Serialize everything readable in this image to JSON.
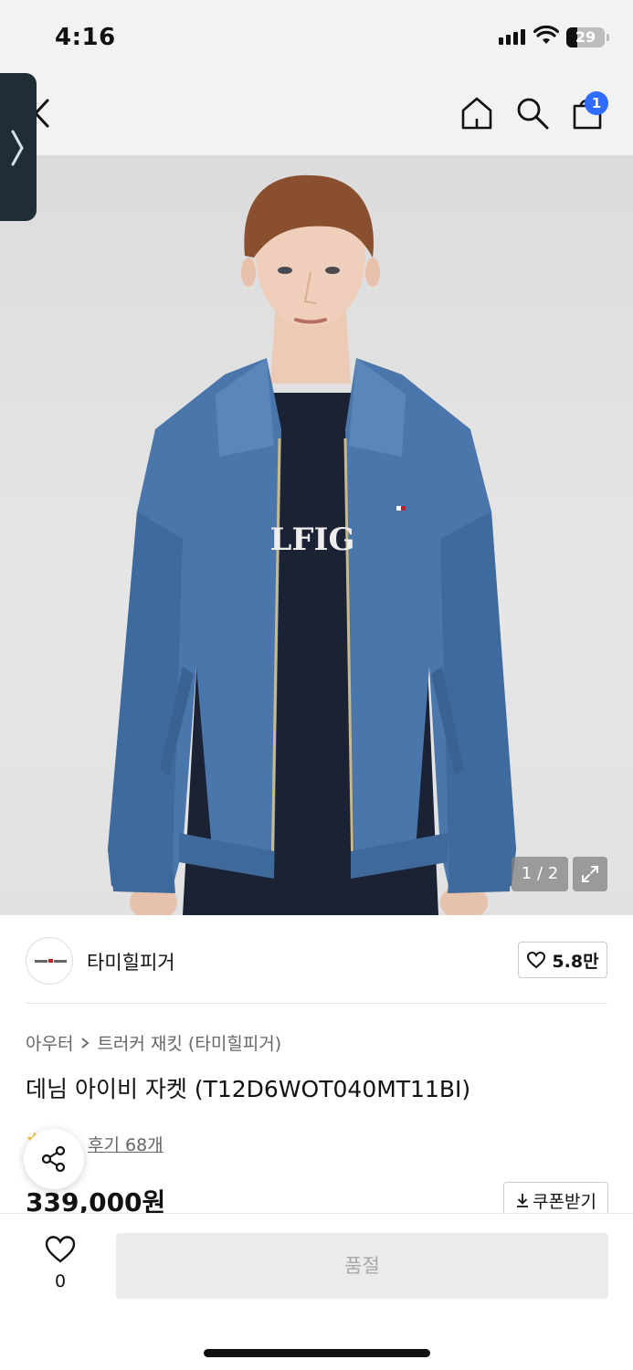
{
  "status_bar": {
    "time": "4:16",
    "battery": "29",
    "battery_level": 0.29
  },
  "header": {
    "cart_count": "1"
  },
  "gallery": {
    "counter": "1 / 2",
    "shirt_print": "LFIG"
  },
  "brand": {
    "name": "타미힐피거",
    "likes": "5.8만",
    "logo_text": "TOMMY HILFIGER"
  },
  "product": {
    "breadcrumb": [
      "아우터",
      "트러커 재킷 (타미힐피거)"
    ],
    "title": "데님 아이비 자켓 (T12D6WOT040MT11BI)",
    "review_link": "후기 68개",
    "price": "339,000원",
    "coupon_label": "쿠폰받기"
  },
  "bottom_bar": {
    "wish_count": "0",
    "buy_button": "품절"
  },
  "colors": {
    "accent": "#2f6bff",
    "denim": "#4a76ab",
    "tee": "#1a2233"
  },
  "icons": [
    "back-icon",
    "home-icon",
    "search-icon",
    "cart-icon",
    "side-tab-chevron-icon",
    "expand-icon",
    "heart-icon",
    "star-icon",
    "share-icon",
    "download-icon"
  ]
}
